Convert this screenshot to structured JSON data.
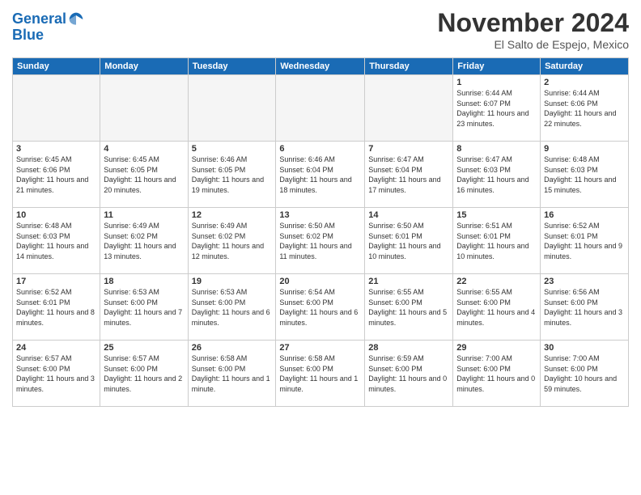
{
  "logo": {
    "line1": "General",
    "line2": "Blue"
  },
  "title": "November 2024",
  "location": "El Salto de Espejo, Mexico",
  "weekdays": [
    "Sunday",
    "Monday",
    "Tuesday",
    "Wednesday",
    "Thursday",
    "Friday",
    "Saturday"
  ],
  "weeks": [
    [
      {
        "day": "",
        "info": ""
      },
      {
        "day": "",
        "info": ""
      },
      {
        "day": "",
        "info": ""
      },
      {
        "day": "",
        "info": ""
      },
      {
        "day": "",
        "info": ""
      },
      {
        "day": "1",
        "info": "Sunrise: 6:44 AM\nSunset: 6:07 PM\nDaylight: 11 hours and 23 minutes."
      },
      {
        "day": "2",
        "info": "Sunrise: 6:44 AM\nSunset: 6:06 PM\nDaylight: 11 hours and 22 minutes."
      }
    ],
    [
      {
        "day": "3",
        "info": "Sunrise: 6:45 AM\nSunset: 6:06 PM\nDaylight: 11 hours and 21 minutes."
      },
      {
        "day": "4",
        "info": "Sunrise: 6:45 AM\nSunset: 6:05 PM\nDaylight: 11 hours and 20 minutes."
      },
      {
        "day": "5",
        "info": "Sunrise: 6:46 AM\nSunset: 6:05 PM\nDaylight: 11 hours and 19 minutes."
      },
      {
        "day": "6",
        "info": "Sunrise: 6:46 AM\nSunset: 6:04 PM\nDaylight: 11 hours and 18 minutes."
      },
      {
        "day": "7",
        "info": "Sunrise: 6:47 AM\nSunset: 6:04 PM\nDaylight: 11 hours and 17 minutes."
      },
      {
        "day": "8",
        "info": "Sunrise: 6:47 AM\nSunset: 6:03 PM\nDaylight: 11 hours and 16 minutes."
      },
      {
        "day": "9",
        "info": "Sunrise: 6:48 AM\nSunset: 6:03 PM\nDaylight: 11 hours and 15 minutes."
      }
    ],
    [
      {
        "day": "10",
        "info": "Sunrise: 6:48 AM\nSunset: 6:03 PM\nDaylight: 11 hours and 14 minutes."
      },
      {
        "day": "11",
        "info": "Sunrise: 6:49 AM\nSunset: 6:02 PM\nDaylight: 11 hours and 13 minutes."
      },
      {
        "day": "12",
        "info": "Sunrise: 6:49 AM\nSunset: 6:02 PM\nDaylight: 11 hours and 12 minutes."
      },
      {
        "day": "13",
        "info": "Sunrise: 6:50 AM\nSunset: 6:02 PM\nDaylight: 11 hours and 11 minutes."
      },
      {
        "day": "14",
        "info": "Sunrise: 6:50 AM\nSunset: 6:01 PM\nDaylight: 11 hours and 10 minutes."
      },
      {
        "day": "15",
        "info": "Sunrise: 6:51 AM\nSunset: 6:01 PM\nDaylight: 11 hours and 10 minutes."
      },
      {
        "day": "16",
        "info": "Sunrise: 6:52 AM\nSunset: 6:01 PM\nDaylight: 11 hours and 9 minutes."
      }
    ],
    [
      {
        "day": "17",
        "info": "Sunrise: 6:52 AM\nSunset: 6:01 PM\nDaylight: 11 hours and 8 minutes."
      },
      {
        "day": "18",
        "info": "Sunrise: 6:53 AM\nSunset: 6:00 PM\nDaylight: 11 hours and 7 minutes."
      },
      {
        "day": "19",
        "info": "Sunrise: 6:53 AM\nSunset: 6:00 PM\nDaylight: 11 hours and 6 minutes."
      },
      {
        "day": "20",
        "info": "Sunrise: 6:54 AM\nSunset: 6:00 PM\nDaylight: 11 hours and 6 minutes."
      },
      {
        "day": "21",
        "info": "Sunrise: 6:55 AM\nSunset: 6:00 PM\nDaylight: 11 hours and 5 minutes."
      },
      {
        "day": "22",
        "info": "Sunrise: 6:55 AM\nSunset: 6:00 PM\nDaylight: 11 hours and 4 minutes."
      },
      {
        "day": "23",
        "info": "Sunrise: 6:56 AM\nSunset: 6:00 PM\nDaylight: 11 hours and 3 minutes."
      }
    ],
    [
      {
        "day": "24",
        "info": "Sunrise: 6:57 AM\nSunset: 6:00 PM\nDaylight: 11 hours and 3 minutes."
      },
      {
        "day": "25",
        "info": "Sunrise: 6:57 AM\nSunset: 6:00 PM\nDaylight: 11 hours and 2 minutes."
      },
      {
        "day": "26",
        "info": "Sunrise: 6:58 AM\nSunset: 6:00 PM\nDaylight: 11 hours and 1 minute."
      },
      {
        "day": "27",
        "info": "Sunrise: 6:58 AM\nSunset: 6:00 PM\nDaylight: 11 hours and 1 minute."
      },
      {
        "day": "28",
        "info": "Sunrise: 6:59 AM\nSunset: 6:00 PM\nDaylight: 11 hours and 0 minutes."
      },
      {
        "day": "29",
        "info": "Sunrise: 7:00 AM\nSunset: 6:00 PM\nDaylight: 11 hours and 0 minutes."
      },
      {
        "day": "30",
        "info": "Sunrise: 7:00 AM\nSunset: 6:00 PM\nDaylight: 10 hours and 59 minutes."
      }
    ]
  ]
}
